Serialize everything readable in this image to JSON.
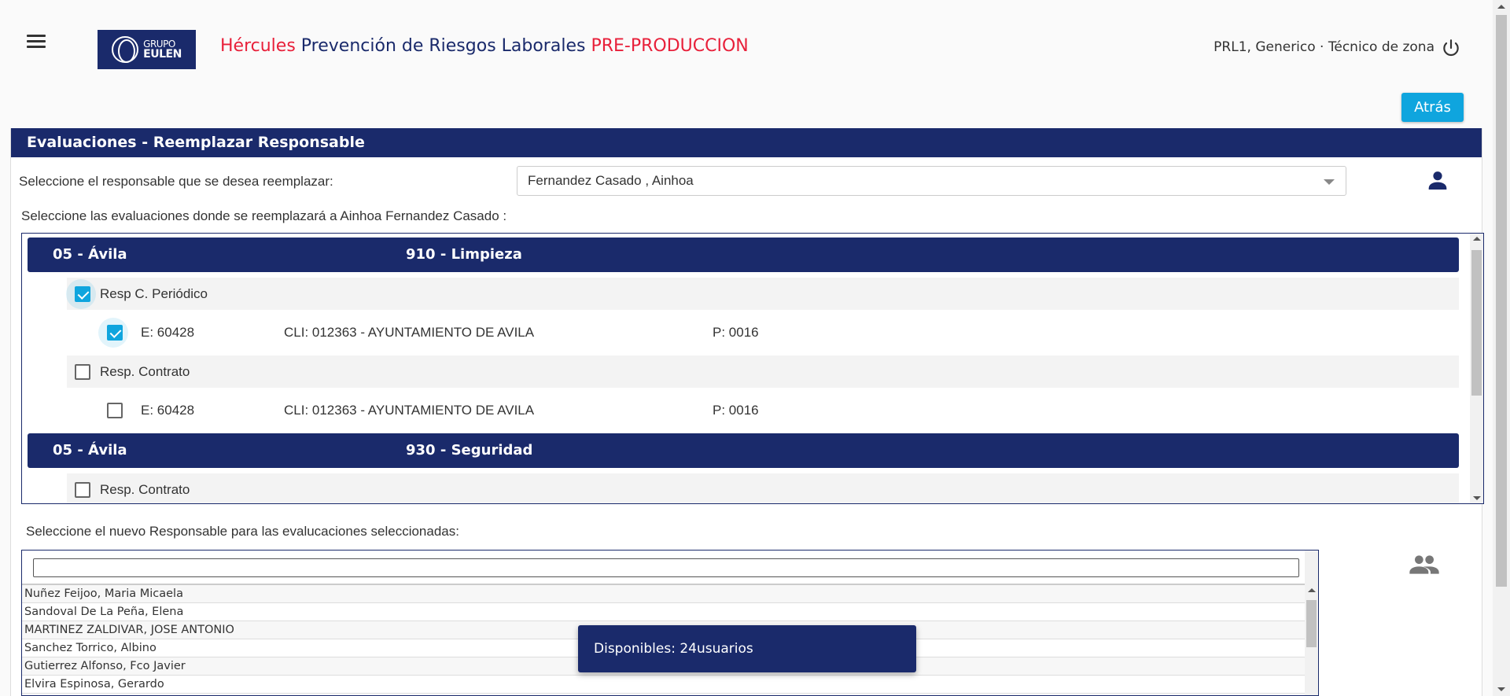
{
  "header": {
    "app_title_part1": "Hércules",
    "app_title_part2": "Prevención de Riesgos Laborales",
    "app_title_part3": "PRE-PRODUCCION",
    "logo_line1": "GRUPO",
    "logo_line2": "EULEN",
    "user": "PRL1, Generico · Técnico de zona"
  },
  "actions": {
    "back_label": "Atrás"
  },
  "panel": {
    "title": "Evaluaciones - Reemplazar Responsable",
    "select_label": "Seleccione el responsable que se desea reemplazar:",
    "selected_responsable": "Fernandez Casado , Ainhoa",
    "eval_label": "Seleccione las evaluaciones donde se reemplazará a Ainhoa Fernandez Casado :",
    "new_label": "Seleccione el nuevo Responsable para las evalucaciones seleccionadas:"
  },
  "groups": [
    {
      "center": "05 - Ávila",
      "service": "910 - Limpieza",
      "subs": [
        {
          "label": "Resp C. Periódico",
          "checked": true,
          "items": [
            {
              "e": "E: 60428",
              "cli": "CLI: 012363 - AYUNTAMIENTO DE AVILA",
              "p": "P: 0016",
              "checked": true
            }
          ]
        },
        {
          "label": "Resp. Contrato",
          "checked": false,
          "items": [
            {
              "e": "E: 60428",
              "cli": "CLI: 012363 - AYUNTAMIENTO DE AVILA",
              "p": "P: 0016",
              "checked": false
            }
          ]
        }
      ]
    },
    {
      "center": "05 - Ávila",
      "service": "930 - Seguridad",
      "subs": [
        {
          "label": "Resp. Contrato",
          "checked": false,
          "items": []
        }
      ]
    }
  ],
  "users": [
    "Nuñez Feijoo, Maria Micaela",
    "Sandoval De La Peña, Elena",
    "MARTINEZ ZALDIVAR, JOSE ANTONIO",
    "Sanchez Torrico, Albino",
    "Gutierrez Alfonso, Fco Javier",
    "Elvira Espinosa, Gerardo"
  ],
  "toast": "Disponibles: 24usuarios",
  "colors": {
    "navy": "#1a2a6b",
    "accent": "#0fa5de",
    "brand_red": "#e8203a"
  },
  "icons": [
    "menu-icon",
    "power-icon",
    "person-icon",
    "group-icon",
    "dropdown-arrow-icon"
  ]
}
